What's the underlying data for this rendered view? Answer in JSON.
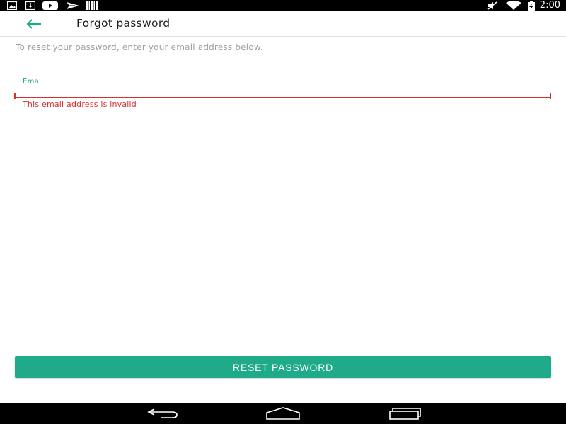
{
  "status_bar": {
    "time": "2:00",
    "left_icons": [
      "gallery-icon",
      "download-icon",
      "youtube-icon",
      "send-icon",
      "barcode-icon"
    ],
    "right_icons": [
      "mute-icon",
      "wifi-icon",
      "battery-icon"
    ]
  },
  "app_bar": {
    "back_icon": "arrow-back-icon",
    "title": "Forgot password"
  },
  "instruction": "To reset your password, enter your email address below.",
  "email_field": {
    "label": "Email",
    "value": "",
    "placeholder": "",
    "error": "This email address is invalid"
  },
  "reset_button": {
    "label": "RESET PASSWORD"
  },
  "colors": {
    "accent": "#1fab89",
    "error": "#d32f2f",
    "title_text": "#212121",
    "hint_text": "#9e9e9e"
  },
  "nav_bar": {
    "buttons": [
      "nav-back-icon",
      "nav-home-icon",
      "nav-recents-icon"
    ]
  }
}
